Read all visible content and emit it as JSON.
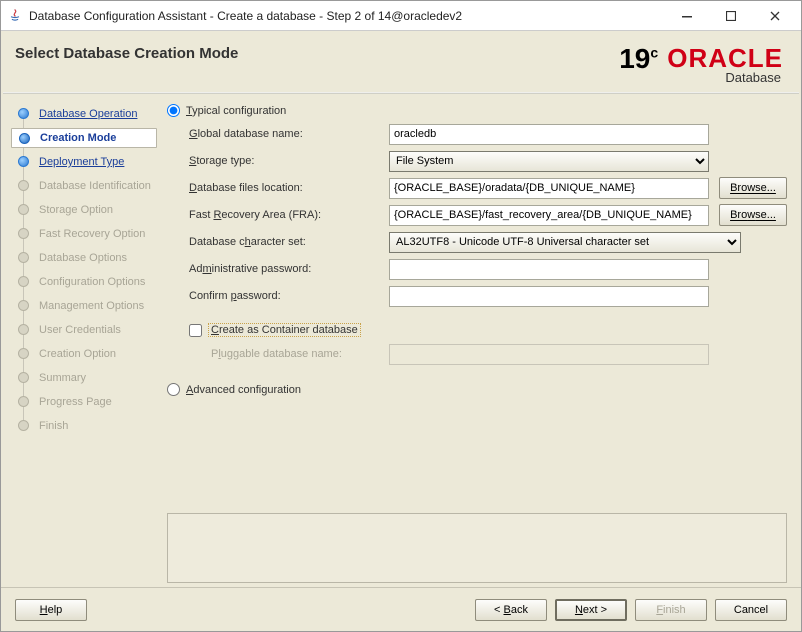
{
  "window": {
    "title": "Database Configuration Assistant - Create a database - Step 2 of 14@oracledev2"
  },
  "header": {
    "title": "Select Database Creation Mode",
    "version": "19",
    "versionSuffix": "c",
    "brand": "ORACLE",
    "product": "Database"
  },
  "steps": [
    {
      "label": "Database Operation",
      "state": "done"
    },
    {
      "label": "Creation Mode",
      "state": "current"
    },
    {
      "label": "Deployment Type",
      "state": "next"
    },
    {
      "label": "Database Identification",
      "state": "disabled"
    },
    {
      "label": "Storage Option",
      "state": "disabled"
    },
    {
      "label": "Fast Recovery Option",
      "state": "disabled"
    },
    {
      "label": "Database Options",
      "state": "disabled"
    },
    {
      "label": "Configuration Options",
      "state": "disabled"
    },
    {
      "label": "Management Options",
      "state": "disabled"
    },
    {
      "label": "User Credentials",
      "state": "disabled"
    },
    {
      "label": "Creation Option",
      "state": "disabled"
    },
    {
      "label": "Summary",
      "state": "disabled"
    },
    {
      "label": "Progress Page",
      "state": "disabled"
    },
    {
      "label": "Finish",
      "state": "disabled"
    }
  ],
  "form": {
    "typicalLabel": "Typical configuration",
    "typicalSelected": true,
    "advancedLabel": "Advanced configuration",
    "advancedSelected": false,
    "globalDbNameLabel": "Global database name:",
    "globalDbName": "oracledb",
    "storageTypeLabel": "Storage type:",
    "storageType": "File System",
    "filesLocLabel": "Database files location:",
    "filesLoc": "{ORACLE_BASE}/oradata/{DB_UNIQUE_NAME}",
    "fraLabel": "Fast Recovery Area (FRA):",
    "fra": "{ORACLE_BASE}/fast_recovery_area/{DB_UNIQUE_NAME}",
    "charsetLabel": "Database character set:",
    "charset": "AL32UTF8 - Unicode UTF-8 Universal character set",
    "adminPwdLabel": "Administrative password:",
    "adminPwd": "",
    "confirmPwdLabel": "Confirm password:",
    "confirmPwd": "",
    "containerChkLabel": "Create as Container database",
    "containerChecked": false,
    "pdbLabel": "Pluggable database name:",
    "pdbName": "",
    "browse": "Browse..."
  },
  "footer": {
    "help": "Help",
    "back": "< Back",
    "next": "Next >",
    "finish": "Finish",
    "cancel": "Cancel"
  }
}
